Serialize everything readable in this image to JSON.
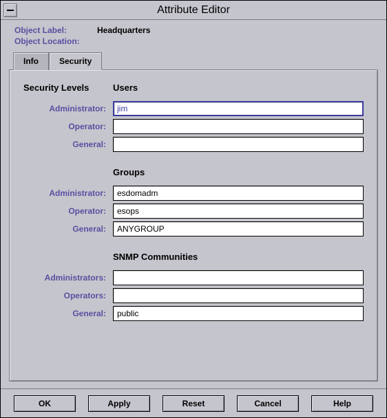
{
  "window": {
    "title": "Attribute Editor"
  },
  "header": {
    "object_label_lbl": "Object Label:",
    "object_label_val": "Headquarters",
    "object_location_lbl": "Object Location:",
    "object_location_val": ""
  },
  "tabs": {
    "info": "Info",
    "security": "Security"
  },
  "panel": {
    "security_levels_heading": "Security Levels",
    "users_heading": "Users",
    "groups_heading": "Groups",
    "snmp_heading": "SNMP Communities",
    "users": {
      "admin_lbl": "Administrator:",
      "admin_val": "jim",
      "operator_lbl": "Operator:",
      "operator_val": "",
      "general_lbl": "General:",
      "general_val": ""
    },
    "groups": {
      "admin_lbl": "Administrator:",
      "admin_val": "esdomadm",
      "operator_lbl": "Operator:",
      "operator_val": "esops",
      "general_lbl": "General:",
      "general_val": "ANYGROUP"
    },
    "snmp": {
      "admins_lbl": "Administrators:",
      "admins_val": "",
      "operators_lbl": "Operators:",
      "operators_val": "",
      "general_lbl": "General:",
      "general_val": "public"
    }
  },
  "buttons": {
    "ok": "OK",
    "apply": "Apply",
    "reset": "Reset",
    "cancel": "Cancel",
    "help": "Help"
  }
}
